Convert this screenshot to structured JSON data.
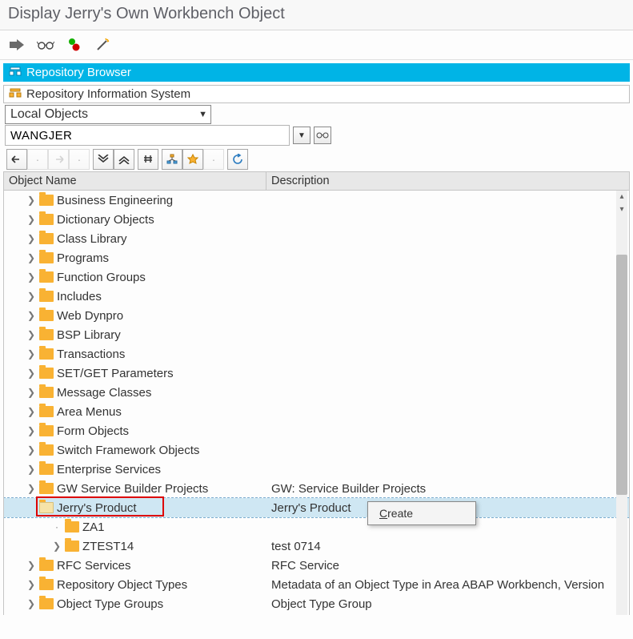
{
  "title": "Display Jerry's Own Workbench Object",
  "sections": {
    "repo_browser": "Repository Browser",
    "repo_info": "Repository Information System"
  },
  "dropdown_value": "Local Objects",
  "input_value": "WANGJER",
  "columns": {
    "name": "Object Name",
    "desc": "Description"
  },
  "context_menu": {
    "create": "Create"
  },
  "tree": [
    {
      "label": "Business Engineering",
      "desc": "",
      "indent": 28,
      "exp": ">",
      "folder": true
    },
    {
      "label": "Dictionary Objects",
      "desc": "",
      "indent": 28,
      "exp": ">",
      "folder": true
    },
    {
      "label": "Class Library",
      "desc": "",
      "indent": 28,
      "exp": ">",
      "folder": true
    },
    {
      "label": "Programs",
      "desc": "",
      "indent": 28,
      "exp": ">",
      "folder": true
    },
    {
      "label": "Function Groups",
      "desc": "",
      "indent": 28,
      "exp": ">",
      "folder": true
    },
    {
      "label": "Includes",
      "desc": "",
      "indent": 28,
      "exp": ">",
      "folder": true
    },
    {
      "label": "Web Dynpro",
      "desc": "",
      "indent": 28,
      "exp": ">",
      "folder": true
    },
    {
      "label": "BSP Library",
      "desc": "",
      "indent": 28,
      "exp": ">",
      "folder": true
    },
    {
      "label": "Transactions",
      "desc": "",
      "indent": 28,
      "exp": ">",
      "folder": true
    },
    {
      "label": "SET/GET Parameters",
      "desc": "",
      "indent": 28,
      "exp": ">",
      "folder": true
    },
    {
      "label": "Message Classes",
      "desc": "",
      "indent": 28,
      "exp": ">",
      "folder": true
    },
    {
      "label": "Area Menus",
      "desc": "",
      "indent": 28,
      "exp": ">",
      "folder": true
    },
    {
      "label": "Form Objects",
      "desc": "",
      "indent": 28,
      "exp": ">",
      "folder": true
    },
    {
      "label": "Switch Framework Objects",
      "desc": "",
      "indent": 28,
      "exp": ">",
      "folder": true
    },
    {
      "label": "Enterprise Services",
      "desc": "",
      "indent": 28,
      "exp": ">",
      "folder": true
    },
    {
      "label": "GW Service Builder Projects",
      "desc": "GW: Service Builder Projects",
      "indent": 28,
      "exp": ">",
      "folder": true
    },
    {
      "label": "Jerry's Product",
      "desc": "Jerry's Product",
      "indent": 28,
      "exp": "",
      "folder": true,
      "open": true,
      "selected": true,
      "highlight": true
    },
    {
      "label": "ZA1",
      "desc": "",
      "indent": 60,
      "exp": "·",
      "folder": true
    },
    {
      "label": "ZTEST14",
      "desc": "test 0714",
      "indent": 60,
      "exp": ">",
      "folder": true
    },
    {
      "label": "RFC Services",
      "desc": "RFC Service",
      "indent": 28,
      "exp": ">",
      "folder": true
    },
    {
      "label": "Repository Object Types",
      "desc": "Metadata of an Object Type in Area ABAP Workbench, Version",
      "indent": 28,
      "exp": ">",
      "folder": true
    },
    {
      "label": "Object Type Groups",
      "desc": "Object Type Group",
      "indent": 28,
      "exp": ">",
      "folder": true
    }
  ]
}
